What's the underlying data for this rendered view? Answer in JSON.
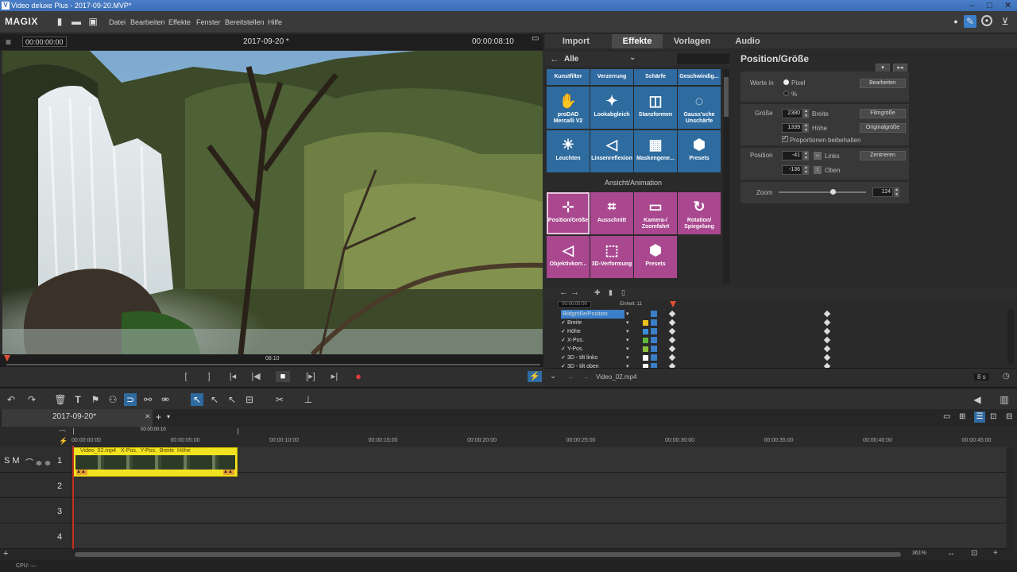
{
  "window": {
    "title": "Video deluxe Plus - 2017-09-20.MVP*"
  },
  "menubar": {
    "brand": "MAGIX",
    "items": [
      "Datei",
      "Bearbeiten",
      "Effekte",
      "Fenster",
      "Bereitstellen",
      "Hilfe"
    ]
  },
  "preview": {
    "timecode_left": "00:00:00:00",
    "project_title": "2017-09-20 *",
    "timecode_right": "00:00:08:10",
    "scrub_label": "08:10"
  },
  "fx": {
    "tabs": [
      "Import",
      "Effekte",
      "Vorlagen",
      "Audio"
    ],
    "filter_label": "Alle",
    "categories": [
      "Kunstfilter",
      "Verzerrung",
      "Schärfe",
      "Geschwindig..."
    ],
    "row1": [
      {
        "label": "proDAD Mercalli V2",
        "icon": "hand-icon"
      },
      {
        "label": "Lookabgleich",
        "icon": "dropper-icon"
      },
      {
        "label": "Stanzformen",
        "icon": "mask-icon"
      },
      {
        "label": "Gauss'sche Unschärfe",
        "icon": "drop-icon"
      }
    ],
    "row2": [
      {
        "label": "Leuchten",
        "icon": "glow-icon"
      },
      {
        "label": "Linsenreflexion",
        "icon": "lens-icon"
      },
      {
        "label": "Maskengene...",
        "icon": "maskgen-icon"
      },
      {
        "label": "Presets",
        "icon": "hexagon-icon"
      }
    ],
    "section": "Ansicht/Animation",
    "row3": [
      {
        "label": "Position/Größe",
        "icon": "position-icon"
      },
      {
        "label": "Ausschnitt",
        "icon": "crop-icon"
      },
      {
        "label": "Kamera-/ Zoomfahrt",
        "icon": "camera-icon"
      },
      {
        "label": "Rotation/ Spiegelung",
        "icon": "rotate-icon"
      }
    ],
    "row4": [
      {
        "label": "Objektivkorr...",
        "icon": "lens-correct-icon"
      },
      {
        "label": "3D-Verformung",
        "icon": "3d-icon"
      },
      {
        "label": "Presets",
        "icon": "hexagon-icon"
      }
    ]
  },
  "props": {
    "title": "Position/Größe",
    "werte_label": "Werte in",
    "unit_pixel": "Pixel",
    "unit_percent": "%",
    "btn_bearbeiten": "Bearbeiten",
    "groesse_label": "Größe",
    "breite_value": "2380",
    "breite_label": "Breite",
    "btn_filmgroesse": "Filmgröße",
    "hoehe_value": "1339",
    "hoehe_label": "Höhe",
    "btn_originalgroesse": "Originalgröße",
    "proportionen": "Proportionen beibehalten",
    "position_label": "Position",
    "links_value": "-41",
    "links_label": "Links",
    "btn_zentrieren": "Zentrieren",
    "oben_value": "-136",
    "oben_label": "Oben",
    "zoom_label": "Zoom",
    "zoom_value": "124",
    "zoom_level": 0.62
  },
  "keyframes": {
    "timecode": "00:00:00:00",
    "unit_label": "Einheit: 11",
    "rows": [
      "Bildgröße/Position",
      "Breite",
      "Höhe",
      "X-Pos.",
      "Y-Pos.",
      "3D - tilt links",
      "3D - tilt oben"
    ],
    "row_colors": [
      "",
      "#e8c21a",
      "#3a8fd8",
      "#5fb83a",
      "#8ac03a",
      "#ffffff",
      "#ffffff"
    ],
    "file_label": "Video_02.mp4",
    "duration": "8 s"
  },
  "timeline": {
    "tab_label": "2017-09-20*",
    "range_timecode": "00:00:00:10",
    "ruler": [
      "00:00:00:00",
      "00:00:05:00",
      "00:00:10:00",
      "00:00:15:00",
      "00:00:20:00",
      "00:00:25:00",
      "00:00:30:00",
      "00:00:35:00",
      "00:00:40:00",
      "00:00:45:00"
    ],
    "track_controls": "S M",
    "tracks": [
      "1",
      "2",
      "3",
      "4"
    ],
    "clip_label": "Video_02.mp4   X-Pos.  Y-Pos.  Breite  Höhe",
    "zoom": "361%"
  },
  "status": {
    "cpu": "CPU: —"
  }
}
